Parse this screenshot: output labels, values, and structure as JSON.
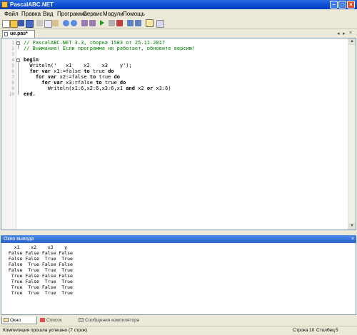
{
  "window": {
    "title": "PascalABC.NET"
  },
  "menu": [
    "Файл",
    "Правка",
    "Вид",
    "Программа",
    "Сервис",
    "Модули",
    "Помощь"
  ],
  "editor": {
    "tab_label": "ue.pas*",
    "line_numbers": [
      "1",
      "2",
      "3",
      "4",
      "5",
      "6",
      "7",
      "8",
      "9",
      "10"
    ],
    "lines": [
      "// PascalABC.NET 3.3, сборка 1583 от 25.11.2017",
      "// Внимание! Если программа не работает, обновите версию!",
      "",
      "begin",
      "  Writeln('   x1    x2    x3    y');",
      "  for var x1:=false to true do",
      "    for var x2:=false to true do",
      "      for var x3:=false to true do",
      "        Writeln(x1:6,x2:6,x3:6,x1 and x2 or x3:6)",
      "end."
    ]
  },
  "output": {
    "title": "Окно вывода",
    "lines": [
      "   x1    x2    x3    y",
      " False False False False",
      " False False  True  True",
      " False  True False False",
      " False  True  True  True",
      "  True False False False",
      "  True False  True  True",
      "  True  True False  True",
      "  True  True  True  True"
    ]
  },
  "bottom_tabs": [
    "Окно вывода",
    "Список ошибок",
    "Сообщения компилятора"
  ],
  "status": {
    "message": "Компиляция прошла успешно (7 строк)",
    "line_label": "Строка",
    "line_value": "10",
    "col_label": "Столбец",
    "col_value": "5"
  },
  "colors": {
    "comment": "#008000",
    "keyword": "#000000"
  }
}
